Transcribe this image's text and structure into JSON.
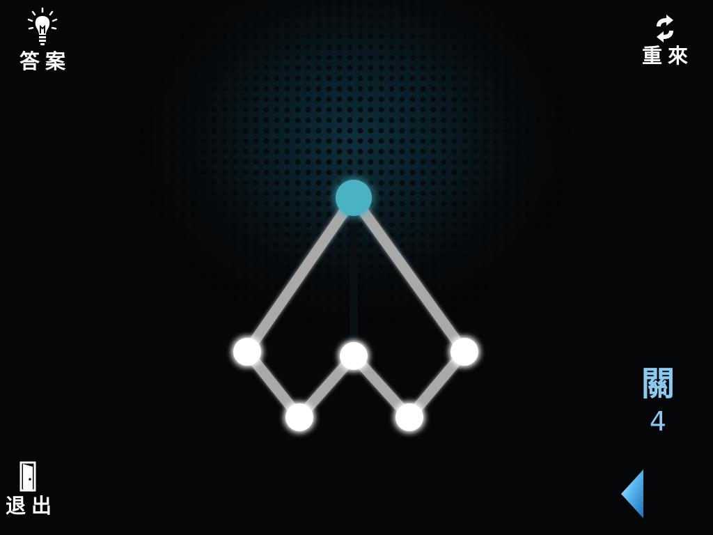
{
  "controls": {
    "answer_label": "答案",
    "restart_label": "重來",
    "exit_label": "退出"
  },
  "level": {
    "label": "關",
    "number": "4"
  },
  "icons": {
    "answer": "lightbulb-icon",
    "restart": "refresh-icon",
    "exit": "door-icon",
    "previous": "triangle-left-icon"
  },
  "colors": {
    "background": "#050607",
    "active_node": "#4ab3c3",
    "node": "#ffffff",
    "drawn_line": "#0a0f14",
    "undrawn_line": "#a9a9a9",
    "level_text": "#8ccaf0",
    "arrow": "#5ab8f0"
  },
  "puzzle": {
    "nodes": [
      "top",
      "left",
      "middle",
      "right",
      "bottom-left",
      "bottom-right"
    ],
    "active_node": "top",
    "edges": [
      {
        "from": "top",
        "to": "left",
        "drawn": false
      },
      {
        "from": "top",
        "to": "right",
        "drawn": false
      },
      {
        "from": "top",
        "to": "middle",
        "drawn": true
      },
      {
        "from": "left",
        "to": "bottom-left",
        "drawn": false
      },
      {
        "from": "bottom-left",
        "to": "middle",
        "drawn": false
      },
      {
        "from": "middle",
        "to": "bottom-right",
        "drawn": false
      },
      {
        "from": "bottom-right",
        "to": "right",
        "drawn": false
      }
    ]
  }
}
